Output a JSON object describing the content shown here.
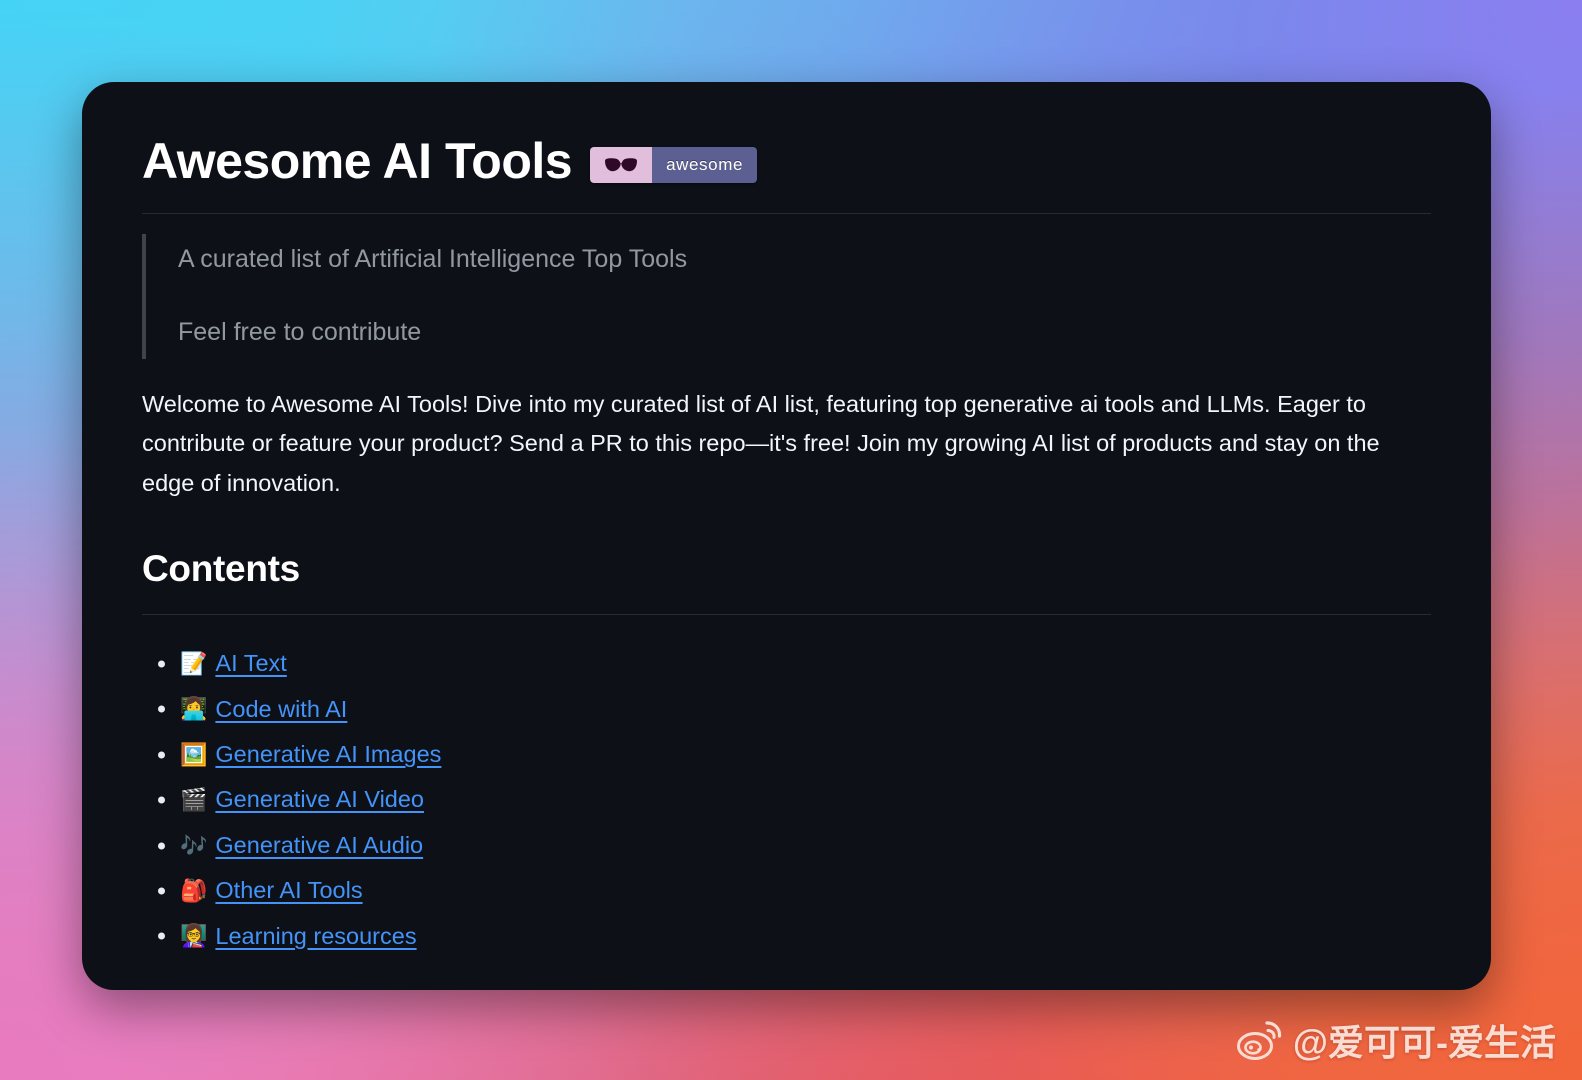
{
  "page": {
    "title": "Awesome AI Tools",
    "badge": {
      "icon_name": "sunglasses-icon",
      "label": "awesome",
      "left_color": "#e2bedd",
      "right_color": "#5c5f91"
    }
  },
  "blockquote": {
    "lines": [
      "A curated list of Artificial Intelligence Top Tools",
      "Feel free to contribute"
    ]
  },
  "intro": {
    "text": "Welcome to Awesome AI Tools! Dive into my curated list of AI list, featuring top generative ai tools and LLMs. Eager to contribute or feature your product? Send a PR to this repo—it's free! Join my growing AI list of products and stay on the edge of innovation."
  },
  "contents": {
    "heading": "Contents",
    "items": [
      {
        "emoji": "📝",
        "icon_name": "memo-emoji",
        "label": "AI Text"
      },
      {
        "emoji": "👩‍💻",
        "icon_name": "woman-technologist-emoji",
        "label": "Code with AI"
      },
      {
        "emoji": "🖼️",
        "icon_name": "framed-picture-emoji",
        "label": "Generative AI Images"
      },
      {
        "emoji": "🎬",
        "icon_name": "clapper-board-emoji",
        "label": "Generative AI Video"
      },
      {
        "emoji": "🎶",
        "icon_name": "musical-notes-emoji",
        "label": "Generative AI Audio"
      },
      {
        "emoji": "🎒",
        "icon_name": "backpack-emoji",
        "label": "Other AI Tools"
      },
      {
        "emoji": "👩‍🏫",
        "icon_name": "woman-teacher-emoji",
        "label": "Learning resources"
      }
    ]
  },
  "watermark": {
    "handle": "@爱可可-爱生活"
  },
  "colors": {
    "card_background": "#0d1117",
    "link": "#4493f8",
    "body_text": "#f0f6fc",
    "muted_text": "#9198a1",
    "divider": "#262c36"
  }
}
